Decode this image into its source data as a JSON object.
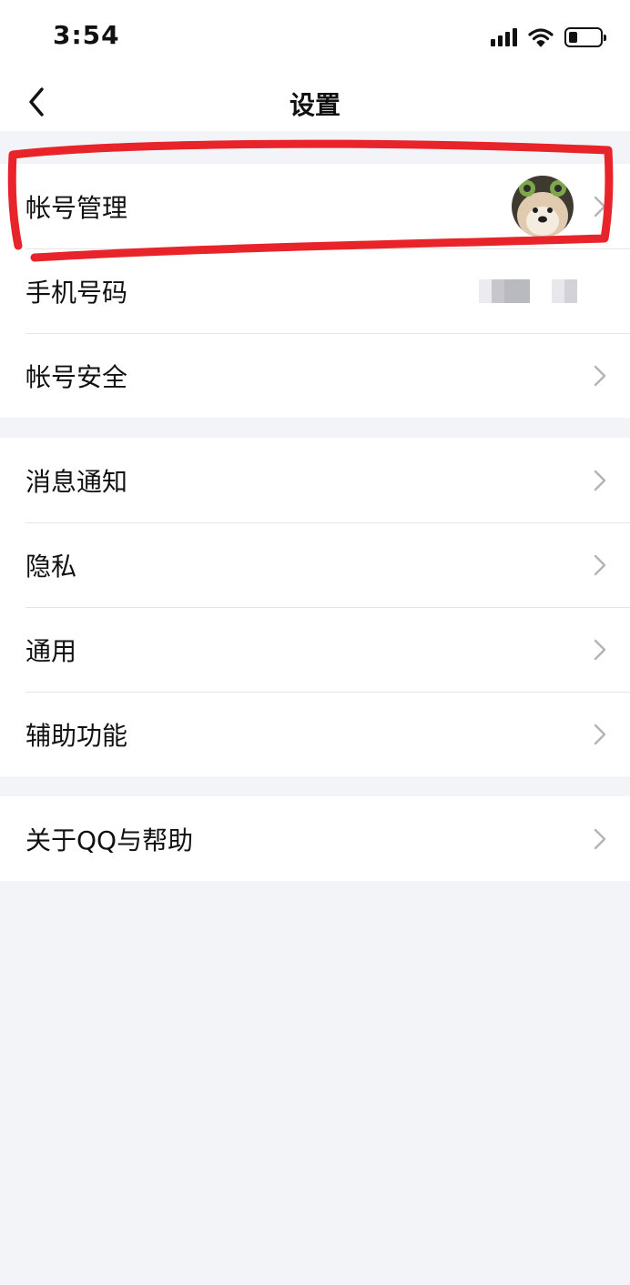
{
  "status_bar": {
    "time": "3:54",
    "icons": [
      "signal-icon",
      "wifi-icon",
      "battery-icon"
    ],
    "battery_level": 0.22
  },
  "nav": {
    "title": "设置",
    "back_icon": "chevron-left-icon"
  },
  "groups": [
    {
      "items": [
        {
          "label": "帐号管理",
          "accessory": "avatar"
        },
        {
          "label": "手机号码",
          "accessory": "blurred-value"
        },
        {
          "label": "帐号安全",
          "accessory": "chevron"
        }
      ]
    },
    {
      "items": [
        {
          "label": "消息通知"
        },
        {
          "label": "隐私"
        },
        {
          "label": "通用"
        },
        {
          "label": "辅助功能"
        }
      ]
    },
    {
      "items": [
        {
          "label": "关于QQ与帮助"
        }
      ]
    }
  ],
  "colors": {
    "background": "#f3f4f8",
    "row_background": "#ffffff",
    "divider": "#e6e6ea",
    "chevron": "#b3b3b8",
    "annotation": "#e8232a"
  }
}
